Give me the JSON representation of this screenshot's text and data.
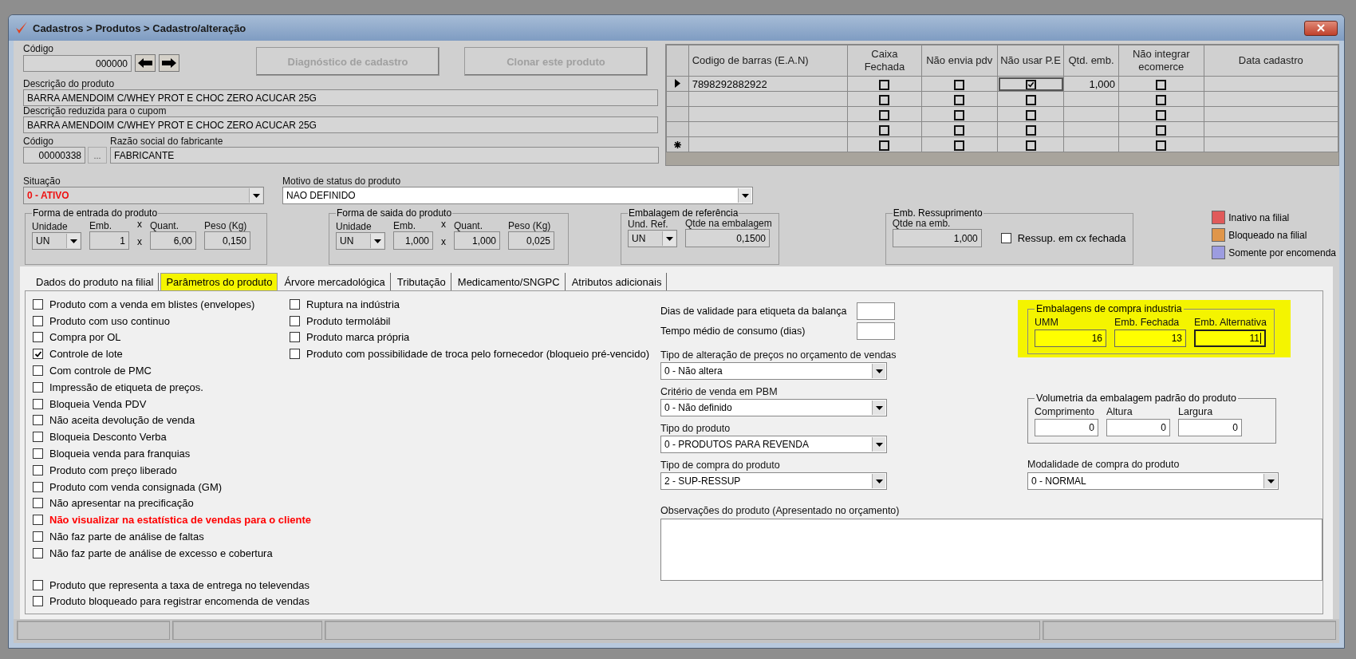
{
  "window": {
    "title": "Cadastros > Produtos > Cadastro/alteração"
  },
  "header": {
    "codigo_label": "Código",
    "codigo_value": "000000",
    "buttons": [
      {
        "label": "Diagnóstico de cadastro",
        "disabled": true
      },
      {
        "label": "Clonar este produto",
        "disabled": true
      }
    ],
    "descricao_label": "Descrição  do produto",
    "descricao_value": "BARRA AMENDOIM C/WHEY PROT E CHOC ZERO ACUCAR 25G",
    "reduzida_label": "Descrição reduzida para o cupom",
    "reduzida_value": "BARRA AMENDOIM C/WHEY PROT E CHOC ZERO ACUCAR 25G",
    "fab_codigo_label": "Código",
    "fab_codigo_value": "00000338",
    "fab_button": "...",
    "razao_label": "Razão social do fabricante",
    "razao_value": "FABRICANTE",
    "situacao_label": "Situação",
    "situacao_value": "0 - ATIVO",
    "motivo_label": "Motivo de status do produto",
    "motivo_value": "NAO DEFINIDO"
  },
  "groups": [
    {
      "title": "Forma de entrada do produto",
      "items": [
        {
          "kind": "select",
          "label": "Unidade",
          "value": "UN"
        },
        {
          "kind": "input",
          "label": "Emb.",
          "value": "1"
        },
        {
          "kind": "times",
          "label": "x",
          "value": "x"
        },
        {
          "kind": "input",
          "label": "Quant.",
          "value": "6,00"
        },
        {
          "kind": "input",
          "label": "Peso (Kg)",
          "value": "0,150"
        }
      ]
    },
    {
      "title": "Forma de saida do produto",
      "items": [
        {
          "kind": "select",
          "label": "Unidade",
          "value": "UN"
        },
        {
          "kind": "input",
          "label": "Emb.",
          "value": "1,000"
        },
        {
          "kind": "times",
          "label": "x",
          "value": "x"
        },
        {
          "kind": "input",
          "label": "Quant.",
          "value": "1,000"
        },
        {
          "kind": "input",
          "label": "Peso (Kg)",
          "value": "0,025"
        }
      ]
    },
    {
      "title": "Embalagem de referência",
      "items": [
        {
          "kind": "select",
          "label": "Und. Ref.",
          "value": "UN"
        },
        {
          "kind": "input",
          "label": "Qtde na embalagem",
          "value": "0,1500"
        }
      ]
    },
    {
      "title": "Emb. Ressuprimento",
      "items": [
        {
          "kind": "input",
          "label": "Qtde na emb.",
          "value": "1,000"
        },
        {
          "kind": "check",
          "label": "Ressup. em cx fechada",
          "checked": false
        }
      ]
    }
  ],
  "legend": [
    {
      "label": "Inativo na filial",
      "color": "#e05a5a"
    },
    {
      "label": "Bloqueado na filial",
      "color": "#e0964a"
    },
    {
      "label": "Somente por encomenda",
      "color": "#9c9ce0"
    }
  ],
  "barcodes": {
    "columns": [
      "Codigo de barras (E.A.N)",
      "Caixa Fechada",
      "Não envia pdv",
      "Não usar P.E",
      "Qtd. emb.",
      "Não integrar ecomerce",
      "Data cadastro"
    ],
    "rows": [
      {
        "current": true,
        "new_row": false,
        "ean": "7898292882922",
        "caixa_fechada": false,
        "nao_envia_pdv": false,
        "nao_usar_pe": true,
        "qtd_emb": "1,000",
        "nao_integrar": false
      },
      {
        "current": false,
        "new_row": false,
        "caixa_fechada": false,
        "nao_envia_pdv": false,
        "nao_usar_pe": false,
        "nao_integrar": false
      },
      {
        "current": false,
        "new_row": false,
        "caixa_fechada": false,
        "nao_envia_pdv": false,
        "nao_usar_pe": false,
        "nao_integrar": false
      },
      {
        "current": false,
        "new_row": false,
        "caixa_fechada": false,
        "nao_envia_pdv": false,
        "nao_usar_pe": false,
        "nao_integrar": false
      },
      {
        "current": false,
        "new_row": true,
        "caixa_fechada": false,
        "nao_envia_pdv": false,
        "nao_usar_pe": false,
        "nao_integrar": false
      }
    ]
  },
  "tabs": [
    {
      "label": "Dados do produto na filial",
      "selected": false,
      "highlighted": false
    },
    {
      "label": "Parâmetros do produto",
      "selected": true,
      "highlighted": true
    },
    {
      "label": "Árvore mercadológica",
      "selected": false,
      "highlighted": false
    },
    {
      "label": "Tributação",
      "selected": false,
      "highlighted": false
    },
    {
      "label": "Medicamento/SNGPC",
      "selected": false,
      "highlighted": false
    },
    {
      "label": "Atributos adicionais",
      "selected": false,
      "highlighted": false
    }
  ],
  "options_column_1": [
    {
      "label": "Produto com a venda em blistes (envelopes)",
      "checked": false,
      "alert": false
    },
    {
      "label": "Produto com uso continuo",
      "checked": false,
      "alert": false
    },
    {
      "label": "Compra por OL",
      "checked": false,
      "alert": false
    },
    {
      "label": "Controle de lote",
      "checked": true,
      "alert": false
    },
    {
      "label": "Com controle de PMC",
      "checked": false,
      "alert": false
    },
    {
      "label": "Impressão de etiqueta de preços.",
      "checked": false,
      "alert": false
    },
    {
      "label": "Bloqueia Venda PDV",
      "checked": false,
      "alert": false
    },
    {
      "label": "Não aceita devolução de venda",
      "checked": false,
      "alert": false
    },
    {
      "label": "Bloqueia Desconto Verba",
      "checked": false,
      "alert": false
    },
    {
      "label": "Bloqueia venda para franquias",
      "checked": false,
      "alert": false
    },
    {
      "label": "Produto com preço liberado",
      "checked": false,
      "alert": false
    },
    {
      "label": "Produto com venda consignada (GM)",
      "checked": false,
      "alert": false
    },
    {
      "label": "Não apresentar na precificação",
      "checked": false,
      "alert": false
    },
    {
      "label": "Não visualizar na estatística de vendas para o cliente",
      "checked": false,
      "alert": true
    },
    {
      "label": "Não faz parte de análise de faltas",
      "checked": false,
      "alert": false
    },
    {
      "label": "Não faz parte de análise de excesso e cobertura",
      "checked": false,
      "alert": false
    }
  ],
  "options_column_1_bottom": [
    {
      "label": "Produto que representa a taxa de entrega no televendas",
      "checked": false
    },
    {
      "label": "Produto bloqueado para registrar encomenda de vendas",
      "checked": false
    }
  ],
  "options_column_2": [
    {
      "label": "Ruptura na indústria",
      "checked": false
    },
    {
      "label": "Produto termolábil",
      "checked": false
    },
    {
      "label": "Produto marca própria",
      "checked": false
    },
    {
      "label": "Produto com possibilidade de troca pelo fornecedor (bloqueio pré-vencido)",
      "checked": false
    }
  ],
  "number_fields": [
    {
      "label": "Dias de validade para etiqueta da balança"
    },
    {
      "label": "Tempo médio de consumo (dias)"
    }
  ],
  "selects": [
    {
      "label": "Tipo de alteração de preços no orçamento de vendas",
      "value": "0 - Não altera"
    },
    {
      "label": "Critério de venda em PBM",
      "value": "0 - Não definido"
    },
    {
      "label": "Tipo do produto",
      "value": "0 - PRODUTOS PARA REVENDA"
    },
    {
      "label": "Tipo de compra do produto",
      "value": "2 - SUP-RESSUP"
    }
  ],
  "observacoes": {
    "label": "Observações do produto (Apresentado no orçamento)"
  },
  "embalagens": {
    "title": "Embalagens de compra industria",
    "highlighted": true,
    "fields": [
      {
        "label": "UMM",
        "value": "16",
        "focused": false
      },
      {
        "label": "Emb. Fechada",
        "value": "13",
        "focused": false
      },
      {
        "label": "Emb. Alternativa",
        "value": "11",
        "focused": true
      }
    ]
  },
  "volumetria": {
    "title": "Volumetria da embalagem padrão do produto",
    "fields": [
      {
        "label": "Comprimento",
        "value": "0"
      },
      {
        "label": "Altura",
        "value": "0"
      },
      {
        "label": "Largura",
        "value": "0"
      }
    ]
  },
  "modalidade": {
    "label": "Modalidade de compra do produto",
    "value": "0 - NORMAL"
  }
}
